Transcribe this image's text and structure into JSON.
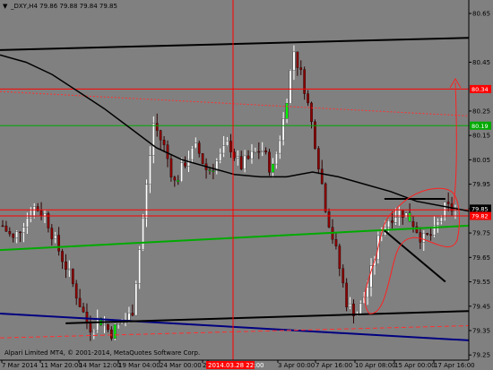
{
  "header": {
    "symbol_line": "_DXY,H4  79.86 79.88 79.84 79.85"
  },
  "copyright": "Alpari Limited MT4, © 2001-2014, MetaQuotes Software Corp.",
  "colors": {
    "background": "#808080",
    "bull": "#ffffff",
    "bear": "#8b0000",
    "highlight": "#00ff00",
    "red_line": "#ff0000",
    "green_line": "#00aa00",
    "black_line": "#000000",
    "blue_line": "#000080",
    "ma_line": "#000000",
    "drawing": "#ff2020"
  },
  "chart_data": {
    "type": "candlestick",
    "symbol": "_DXY",
    "timeframe": "H4",
    "ylim": [
      79.25,
      80.6
    ],
    "y_ticks": [
      "80.65",
      "80.45",
      "80.25",
      "80.15",
      "80.05",
      "79.95",
      "79.85",
      "79.75",
      "79.65",
      "79.55",
      "79.45",
      "79.35",
      "79.25"
    ],
    "x_ticks": [
      "7 Mar 2014",
      "11 Mar 20:00",
      "14 Mar 12:00",
      "19 Mar 04:00",
      "24 Mar 00:00",
      "26",
      "2014.03.28 22:00",
      "3 Apr 00:00",
      "7 Apr 16:00",
      "10 Apr 08:00",
      "15 Apr 00:00",
      "17 Apr 16:00"
    ],
    "crosshair_x_label": "2014.03.28 22:00",
    "price_tags": [
      {
        "label": "80.34",
        "value": 80.34,
        "color": "#ff0000"
      },
      {
        "label": "80.19",
        "value": 80.19,
        "color": "#00aa00"
      },
      {
        "label": "79.85",
        "value": 79.85,
        "color": "#000000"
      },
      {
        "label": "79.82",
        "value": 79.82,
        "color": "#ff0000"
      }
    ],
    "horizontal_lines": [
      {
        "value": 80.34,
        "color": "#ff0000",
        "style": "solid"
      },
      {
        "value": 80.19,
        "color": "#00aa00",
        "style": "solid"
      },
      {
        "value": 79.82,
        "color": "#ff0000",
        "style": "solid"
      },
      {
        "value": 79.845,
        "color": "#ff0000",
        "style": "solid"
      }
    ],
    "trendlines": [
      {
        "name": "upper-resistance",
        "color": "#000000",
        "from": [
          0,
          80.5
        ],
        "to": [
          1,
          80.55
        ]
      },
      {
        "name": "dotted-red",
        "color": "#ff3030",
        "from": [
          0,
          80.33
        ],
        "to": [
          1,
          80.23
        ],
        "style": "dotted"
      },
      {
        "name": "green-support",
        "color": "#00aa00",
        "from": [
          0,
          79.68
        ],
        "to": [
          1,
          79.78
        ]
      },
      {
        "name": "blue-lower",
        "color": "#000080",
        "from": [
          0,
          79.42
        ],
        "to": [
          1,
          79.31
        ]
      },
      {
        "name": "black-lower",
        "color": "#000000",
        "from": [
          0.14,
          79.38
        ],
        "to": [
          1,
          79.43
        ]
      },
      {
        "name": "red-dashed-lower",
        "color": "#ff3030",
        "from": [
          0,
          79.32
        ],
        "to": [
          1,
          79.37
        ],
        "style": "dashed"
      },
      {
        "name": "flag-top",
        "color": "#000000",
        "from": [
          0.82,
          79.89
        ],
        "to": [
          0.95,
          79.89
        ]
      },
      {
        "name": "flag-down",
        "color": "#000000",
        "from": [
          0.82,
          79.76
        ],
        "to": [
          0.95,
          79.55
        ]
      }
    ],
    "moving_average": [
      80.48,
      80.45,
      80.4,
      80.33,
      80.26,
      80.18,
      80.1,
      80.05,
      80.02,
      79.99,
      79.98,
      79.98,
      80.0,
      79.98,
      79.95,
      79.92,
      79.88,
      79.86,
      79.84
    ],
    "candles": {
      "count": 130,
      "close_path": [
        79.78,
        79.72,
        79.8,
        79.86,
        79.82,
        79.7,
        79.6,
        79.48,
        79.36,
        79.4,
        79.34,
        79.38,
        79.42,
        79.8,
        80.2,
        80.1,
        79.95,
        80.05,
        80.1,
        80.0,
        80.05,
        80.12,
        80.02,
        80.06,
        80.1,
        80.0,
        80.2,
        80.5,
        80.35,
        80.12,
        79.85,
        79.66,
        79.45,
        79.42,
        79.55,
        79.75,
        79.82,
        79.84,
        79.8,
        79.72,
        79.75,
        79.85,
        79.85
      ]
    }
  }
}
